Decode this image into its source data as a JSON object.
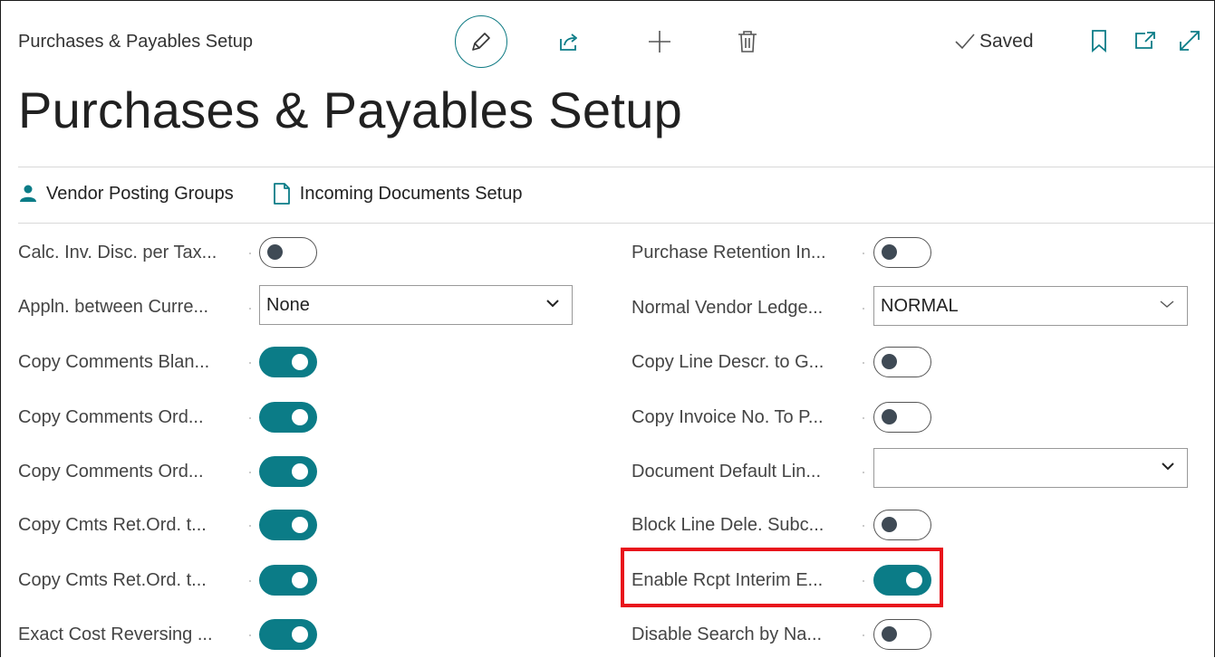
{
  "header": {
    "breadcrumb": "Purchases & Payables Setup",
    "saved_label": "Saved",
    "title": "Purchases & Payables Setup"
  },
  "actions": [
    {
      "label": "Vendor Posting Groups",
      "icon": "person-icon"
    },
    {
      "label": "Incoming Documents Setup",
      "icon": "document-icon"
    }
  ],
  "left_fields": [
    {
      "label": "Calc. Inv. Disc. per Tax...",
      "type": "toggle",
      "on": false
    },
    {
      "label": "Appln. between Curre...",
      "type": "select",
      "value": "None"
    },
    {
      "label": "Copy Comments Blan...",
      "type": "toggle",
      "on": true
    },
    {
      "label": "Copy Comments Ord...",
      "type": "toggle",
      "on": true
    },
    {
      "label": "Copy Comments Ord...",
      "type": "toggle",
      "on": true
    },
    {
      "label": "Copy Cmts Ret.Ord. t...",
      "type": "toggle",
      "on": true
    },
    {
      "label": "Copy Cmts Ret.Ord. t...",
      "type": "toggle",
      "on": true
    },
    {
      "label": "Exact Cost Reversing ...",
      "type": "toggle",
      "on": true
    }
  ],
  "right_fields": [
    {
      "label": "Purchase Retention In...",
      "type": "toggle",
      "on": false
    },
    {
      "label": "Normal Vendor Ledge...",
      "type": "select",
      "value": "NORMAL"
    },
    {
      "label": "Copy Line Descr. to G...",
      "type": "toggle",
      "on": false
    },
    {
      "label": "Copy Invoice No. To P...",
      "type": "toggle",
      "on": false
    },
    {
      "label": "Document Default Lin...",
      "type": "select",
      "value": ""
    },
    {
      "label": "Block Line Dele. Subc...",
      "type": "toggle",
      "on": false
    },
    {
      "label": "Enable Rcpt Interim E...",
      "type": "toggle",
      "on": true
    },
    {
      "label": "Disable Search by Na...",
      "type": "toggle",
      "on": false
    }
  ],
  "colors": {
    "accent": "#0b7c87",
    "highlight": "#e8141b"
  }
}
